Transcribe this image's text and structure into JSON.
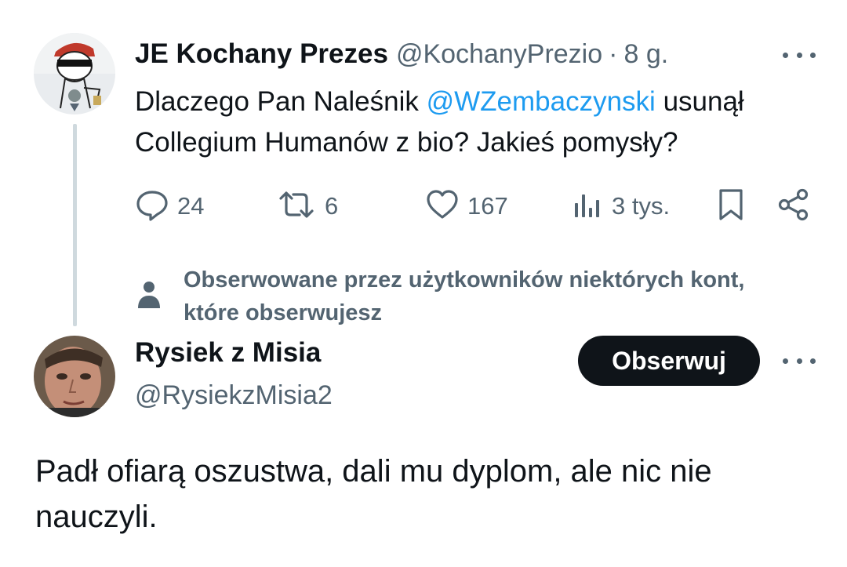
{
  "tweet": {
    "author_name": "JE Kochany Prezes",
    "author_handle": "@KochanyPrezio",
    "separator": "·",
    "time": "8 g.",
    "text_before": "Dlaczego Pan Naleśnik ",
    "mention": "@WZembaczynski",
    "text_after": " usunął Collegium Humanów z bio? Jakieś pomysły?",
    "actions": {
      "replies": "24",
      "reposts": "6",
      "likes": "167",
      "views": "3 tys."
    }
  },
  "social_context": {
    "text": "Obserwowane przez użytkowników niektórych kont, które obserwujesz"
  },
  "reply": {
    "author_name": "Rysiek z Misia",
    "author_handle": "@RysiekzMisia2",
    "follow_label": "Obserwuj",
    "text": "Padł ofiarą oszustwa, dali mu dyplom, ale nic nie nauczyli."
  },
  "icons": {
    "reply": "speech-bubble-icon",
    "repost": "repost-arrows-icon",
    "like": "heart-icon",
    "views": "bar-chart-icon",
    "bookmark": "bookmark-icon",
    "share": "share-icon",
    "more": "more-dots-icon",
    "person": "person-icon"
  },
  "colors": {
    "text": "#0f1419",
    "secondary": "#536471",
    "mention": "#1d9bf0",
    "thread_line": "#cfd9de",
    "follow_button_bg": "#0f1419"
  }
}
